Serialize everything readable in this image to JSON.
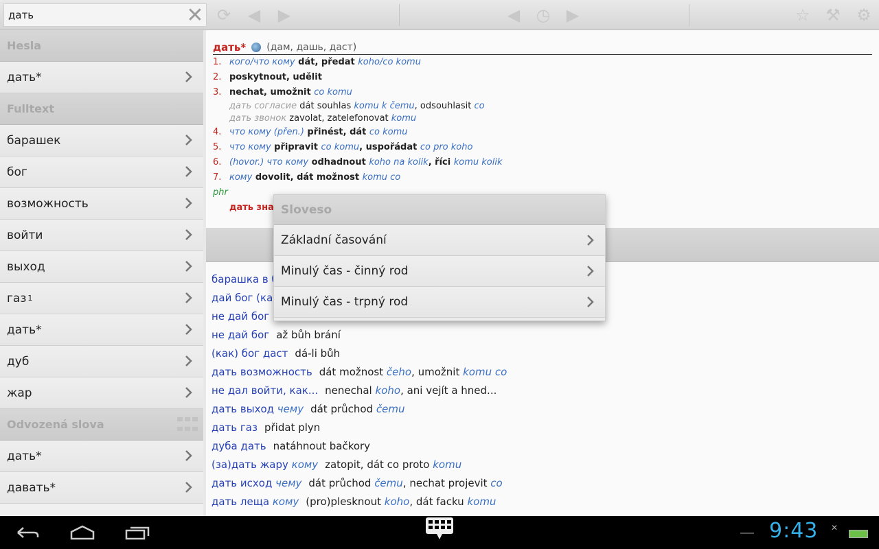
{
  "toolbar": {
    "search_value": "дать",
    "icons": [
      "clear-icon",
      "refresh-icon",
      "back-icon",
      "forward-icon",
      "history-back-icon",
      "history-icon",
      "history-forward-icon",
      "star-icon",
      "tools-icon",
      "settings-icon"
    ]
  },
  "sidebar": {
    "headwords_header": "Hesla",
    "headwords": [
      {
        "label": "дать*"
      }
    ],
    "fulltext_header": "Fulltext",
    "fulltext": [
      {
        "label": "барашек"
      },
      {
        "label": "бог"
      },
      {
        "label": "возможность"
      },
      {
        "label": "войти"
      },
      {
        "label": "выход"
      },
      {
        "label": "газ",
        "sup": "1"
      },
      {
        "label": "дать*"
      },
      {
        "label": "дуб"
      },
      {
        "label": "жар"
      }
    ],
    "derived_header": "Odvozená slova",
    "derived": [
      {
        "label": "дать*"
      },
      {
        "label": "давать*"
      }
    ]
  },
  "entry": {
    "headword": "дать*",
    "forms": "(дам, дашь, даст)",
    "senses": [
      {
        "n": "1.",
        "parts": [
          [
            "i",
            "кого/что кому"
          ],
          [
            "b",
            " dát, předat "
          ],
          [
            "i",
            "koho/co komu"
          ]
        ]
      },
      {
        "n": "2.",
        "parts": [
          [
            "b",
            "poskytnout, udělit"
          ]
        ]
      },
      {
        "n": "3.",
        "parts": [
          [
            "b",
            "nechat, umožnit "
          ],
          [
            "i",
            "co komu"
          ]
        ]
      },
      {
        "n": "4.",
        "parts": [
          [
            "i",
            "что кому (přen.)"
          ],
          [
            "b",
            " přinést, dát "
          ],
          [
            "i",
            "co komu"
          ]
        ]
      },
      {
        "n": "5.",
        "parts": [
          [
            "i",
            "что кому"
          ],
          [
            "b",
            " připravit "
          ],
          [
            "i",
            "co komu"
          ],
          [
            "b",
            ", uspořádat "
          ],
          [
            "i",
            "co pro koho"
          ]
        ]
      },
      {
        "n": "6.",
        "parts": [
          [
            "i",
            "(hovor.) что кому"
          ],
          [
            "b",
            " odhadnout "
          ],
          [
            "i",
            "koho na kolik"
          ],
          [
            "b",
            ", říci "
          ],
          [
            "i",
            "komu kolik"
          ]
        ]
      },
      {
        "n": "7.",
        "parts": [
          [
            "i",
            "кому"
          ],
          [
            "b",
            " dovolit, dát možnost "
          ],
          [
            "i",
            "komu co"
          ]
        ]
      }
    ],
    "sub_examples": [
      [
        [
          "g",
          "дать согласие"
        ],
        [
          "n",
          " dát souhlas "
        ],
        [
          "i",
          "komu k čemu"
        ],
        [
          "n",
          ", odsouhlasit "
        ],
        [
          "i",
          "co"
        ]
      ],
      [
        [
          "g",
          "дать звонок"
        ],
        [
          "n",
          " zavolat, zatelefonovat "
        ],
        [
          "i",
          "komu"
        ]
      ]
    ],
    "phr_label": "phr",
    "phr_text": "дать знат"
  },
  "results": [
    {
      "ru": [
        [
          "",
          "барашка в б"
        ]
      ],
      "cz": []
    },
    {
      "ru": [
        [
          "",
          "дай бог (каж"
        ]
      ],
      "cz": []
    },
    {
      "ru": [
        [
          "",
          "не дай бог"
        ]
      ],
      "cz": []
    },
    {
      "ru": [
        [
          "",
          "не дай бог"
        ]
      ],
      "cz": [
        [
          "",
          "až bůh brání"
        ]
      ]
    },
    {
      "ru": [
        [
          "",
          "(как) бог даст"
        ]
      ],
      "cz": [
        [
          "",
          "dá-li bůh"
        ]
      ]
    },
    {
      "ru": [
        [
          "",
          "дать возможность"
        ]
      ],
      "cz": [
        [
          "",
          "dát možnost "
        ],
        [
          "i",
          "čeho"
        ],
        [
          "",
          ", umožnit "
        ],
        [
          "i",
          "komu co"
        ]
      ]
    },
    {
      "ru": [
        [
          "",
          "не дал войти, как..."
        ]
      ],
      "cz": [
        [
          "",
          "nenechal "
        ],
        [
          "i",
          "koho"
        ],
        [
          "",
          ", ani vejít a hned..."
        ]
      ]
    },
    {
      "ru": [
        [
          "",
          "дать выход "
        ],
        [
          "i",
          "чему"
        ]
      ],
      "cz": [
        [
          "",
          "dát průchod "
        ],
        [
          "i",
          "čemu"
        ]
      ]
    },
    {
      "ru": [
        [
          "",
          "дать газ"
        ]
      ],
      "cz": [
        [
          "",
          "přidat plyn"
        ]
      ]
    },
    {
      "ru": [
        [
          "",
          "дуба дать"
        ]
      ],
      "cz": [
        [
          "",
          "natáhnout bačkory"
        ]
      ]
    },
    {
      "ru": [
        [
          "",
          "(за)дать жару "
        ],
        [
          "i",
          "кому"
        ]
      ],
      "cz": [
        [
          "",
          "zatopit, dát co proto "
        ],
        [
          "i",
          "komu"
        ]
      ]
    },
    {
      "ru": [
        [
          "",
          "дать исход "
        ],
        [
          "i",
          "чему"
        ]
      ],
      "cz": [
        [
          "",
          "dát průchod "
        ],
        [
          "i",
          "čemu"
        ],
        [
          "",
          ", nechat projevit "
        ],
        [
          "i",
          "co"
        ]
      ]
    },
    {
      "ru": [
        [
          "",
          "дать леща "
        ],
        [
          "i",
          "кому"
        ]
      ],
      "cz": [
        [
          "",
          "(pro)plesknout "
        ],
        [
          "i",
          "koho"
        ],
        [
          "",
          ", dát facku "
        ],
        [
          "i",
          "komu"
        ]
      ]
    }
  ],
  "dialog": {
    "title": "Sloveso",
    "items": [
      {
        "label": "Základní časování"
      },
      {
        "label": "Minulý čas - činný rod"
      },
      {
        "label": "Minulý čas - trpný rod"
      }
    ]
  },
  "status": {
    "time": "9:43"
  }
}
